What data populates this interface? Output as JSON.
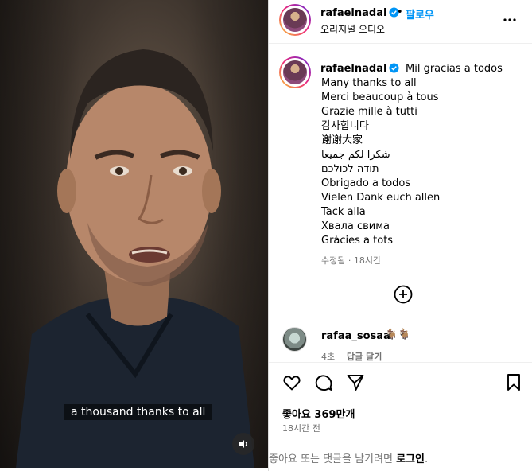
{
  "video": {
    "subtitle": "a thousand thanks to all"
  },
  "header": {
    "username": "rafaelnadal",
    "separator": "•",
    "follow_label": "팔로우",
    "audio_label": "오리지널 오디오"
  },
  "caption": {
    "username": "rafaelnadal",
    "first_line": "Mil gracias a todos",
    "lines": [
      "Many thanks to all",
      "Merci beaucoup à tous",
      "Grazie mille à tutti",
      "감사합니다",
      "谢谢大家",
      "شكرا لكم جميعا",
      "תודה לכולכם",
      "Obrigado a todos",
      "Vielen Dank euch allen",
      "Tack alla",
      "Хвала свима",
      "Gràcies a tots"
    ],
    "edited_label": "수정됨",
    "meta_separator": "·",
    "time_ago": "18시간"
  },
  "comment": {
    "username": "rafaa_sosaa",
    "text": "🐐🐐",
    "age": "4초",
    "reply_label": "답글 달기"
  },
  "stats": {
    "likes": "좋아요 369만개",
    "posted": "18시간 전"
  },
  "footer": {
    "prompt": "좋아요 또는 댓글을 남기려면 ",
    "login_label": "로그인",
    "period": "."
  },
  "colors": {
    "accent": "#0095f6",
    "muted": "#737373"
  },
  "icons": [
    "verified-icon",
    "more-icon",
    "add-comment-icon",
    "heart-icon",
    "comment-icon",
    "share-icon",
    "bookmark-icon",
    "speaker-icon"
  ]
}
